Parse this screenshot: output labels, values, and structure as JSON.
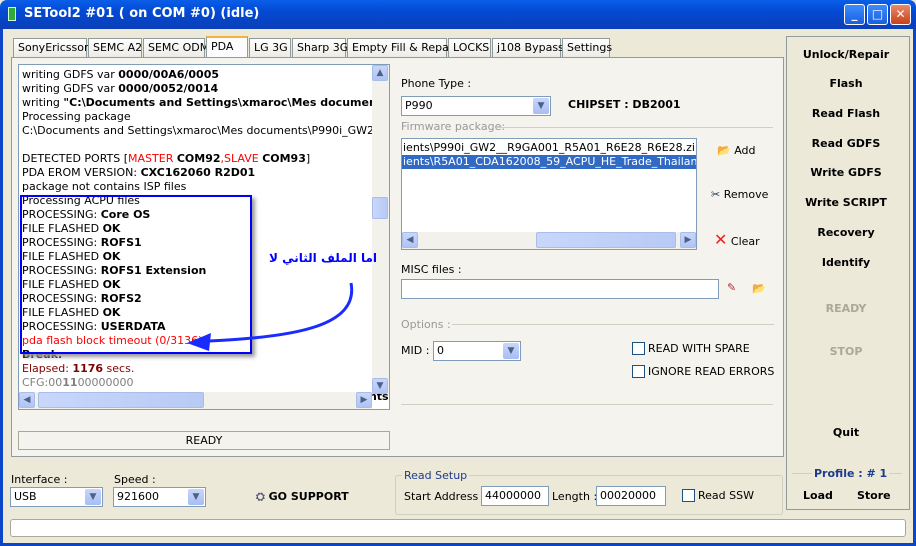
{
  "window": {
    "title": "SETool2 #01 ( on COM #0) (idle)",
    "minimize": "_",
    "maximize": "□",
    "close": "✕"
  },
  "tabs": [
    {
      "label": "SonyEricsson"
    },
    {
      "label": "SEMC A2"
    },
    {
      "label": "SEMC ODM"
    },
    {
      "label": "PDA",
      "active": true
    },
    {
      "label": "LG 3G"
    },
    {
      "label": "Sharp 3G"
    },
    {
      "label": "Empty Fill & Repair"
    },
    {
      "label": "LOCKS"
    },
    {
      "label": "j108 Bypass"
    },
    {
      "label": "Settings"
    }
  ],
  "log": {
    "lines": [
      [
        {
          "t": "writing GDFS var "
        },
        {
          "t": "0000/00A6/0005",
          "b": true
        }
      ],
      [
        {
          "t": "writing GDFS var "
        },
        {
          "t": "0000/0052/0014",
          "b": true
        }
      ],
      [
        {
          "t": "writing "
        },
        {
          "t": "\"C:\\Documents and Settings\\xmaroc\\Mes documents\\P",
          "b": true
        }
      ],
      [
        {
          "t": "Processing package"
        }
      ],
      [
        {
          "t": "C:\\Documents and Settings\\xmaroc\\Mes documents\\P990i_GW2__R9GA0"
        }
      ],
      [
        {
          "t": " "
        }
      ],
      [
        {
          "t": "DETECTED PORTS ["
        },
        {
          "t": "MASTER ",
          "c": "red"
        },
        {
          "t": "COM92",
          "b": true
        },
        {
          "t": ",SLAVE ",
          "c": "red"
        },
        {
          "t": "COM93",
          "b": true
        },
        {
          "t": "]"
        }
      ],
      [
        {
          "t": "PDA EROM VERSION: "
        },
        {
          "t": "CXC162060 R2D01",
          "b": true
        }
      ],
      [
        {
          "t": "package not contains ISP files"
        }
      ],
      [
        {
          "t": "Processing ACPU files"
        }
      ],
      [
        {
          "t": "PROCESSING: "
        },
        {
          "t": "Core OS",
          "b": true
        }
      ],
      [
        {
          "t": "FILE FLASHED "
        },
        {
          "t": "OK",
          "b": true
        }
      ],
      [
        {
          "t": "PROCESSING: "
        },
        {
          "t": "ROFS1",
          "b": true
        }
      ],
      [
        {
          "t": "FILE FLASHED "
        },
        {
          "t": "OK",
          "b": true
        }
      ],
      [
        {
          "t": "PROCESSING: "
        },
        {
          "t": "ROFS1 Extension",
          "b": true
        }
      ],
      [
        {
          "t": "FILE FLASHED "
        },
        {
          "t": "OK",
          "b": true
        }
      ],
      [
        {
          "t": "PROCESSING: "
        },
        {
          "t": "ROFS2",
          "b": true
        }
      ],
      [
        {
          "t": "FILE FLASHED "
        },
        {
          "t": "OK",
          "b": true
        }
      ],
      [
        {
          "t": "PROCESSING: "
        },
        {
          "t": "USERDATA",
          "b": true
        }
      ],
      [
        {
          "t": "pda flash block timeout (0/3136)",
          "c": "red"
        }
      ],
      [
        {
          "t": "Break.",
          "b": true
        }
      ],
      [
        {
          "t": "Elapsed: ",
          "c": "dred"
        },
        {
          "t": "1176",
          "b": true,
          "c": "dred"
        },
        {
          "t": " secs.",
          "c": "dred"
        }
      ],
      [
        {
          "t": "CFG:00",
          "c": "grey"
        },
        {
          "t": "11",
          "b": true,
          "c": "grey"
        },
        {
          "t": "00000000",
          "c": "grey"
        }
      ],
      [
        {
          "t": "writing "
        },
        {
          "t": "\"C:\\Documents and Settings\\xmaroc\\Mes documents\\P",
          "b": true
        }
      ],
      [
        {
          "t": "Processing package"
        }
      ]
    ],
    "annotation": "اما الملف الثاني لا",
    "annotation_color": "#0000ff",
    "status": "READY"
  },
  "phone": {
    "label": "Phone Type :",
    "value": "P990",
    "chipset": "CHIPSET : DB2001"
  },
  "firmware": {
    "label": "Firmware package:",
    "files": [
      "ients\\P990i_GW2__R9GA001_R5A01_R6E28_R6E28.zip",
      "ients\\R5A01_CDA162008_59_ACPU_HE_Trade_Thailand.zip"
    ],
    "selected": 1,
    "add": "Add",
    "remove": "Remove",
    "clear": "Clear"
  },
  "misc": {
    "label": "MISC files :",
    "value": ""
  },
  "options": {
    "label": "Options :",
    "mid_label": "MID :",
    "mid_value": "0",
    "read_with_spare": "READ WITH SPARE",
    "ignore_read_errors": "IGNORE READ ERRORS"
  },
  "actions": {
    "unlock": "Unlock/Repair",
    "flash": "Flash",
    "read_flash": "Read Flash",
    "read_gdfs": "Read GDFS",
    "write_gdfs": "Write GDFS",
    "write_script": "Write SCRIPT",
    "recovery": "Recovery",
    "identify": "Identify",
    "ready": "READY",
    "stop": "STOP",
    "quit": "Quit",
    "profile": "Profile : # 1",
    "load": "Load",
    "store": "Store"
  },
  "bottom": {
    "interface_label": "Interface :",
    "interface_value": "USB",
    "speed_label": "Speed :",
    "speed_value": "921600",
    "go_support": "GO SUPPORT"
  },
  "read_setup": {
    "label": "Read Setup",
    "start_label": "Start Address :",
    "start_value": "44000000",
    "length_label": "Length :",
    "length_value": "00020000",
    "read_ssw": "Read SSW"
  },
  "progress": 0
}
